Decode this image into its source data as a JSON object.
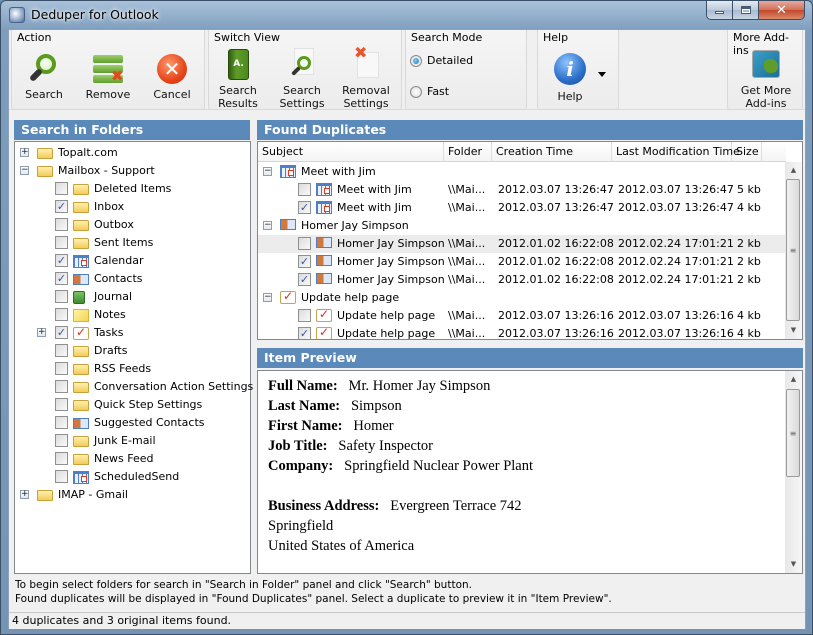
{
  "window": {
    "title": "Deduper for Outlook",
    "controls": {
      "minimize": "minimize",
      "maximize": "maximize",
      "close": "✕"
    }
  },
  "ribbon": {
    "groups": {
      "action": {
        "label": "Action",
        "buttons": [
          {
            "label": "Search",
            "icon": "magnifier-icon"
          },
          {
            "label": "Remove",
            "icon": "remove-stack-icon"
          },
          {
            "label": "Cancel",
            "icon": "cancel-icon"
          }
        ]
      },
      "switch_view": {
        "label": "Switch View",
        "buttons": [
          {
            "line1": "Search",
            "line2": "Results",
            "icon": "results-book-icon",
            "glyph": "A."
          },
          {
            "line1": "Search",
            "line2": "Settings",
            "icon": "search-settings-icon"
          },
          {
            "line1": "Removal",
            "line2": "Settings",
            "icon": "removal-settings-icon"
          }
        ]
      },
      "search_mode": {
        "label": "Search Mode",
        "options": [
          {
            "label": "Detailed",
            "selected": true
          },
          {
            "label": "Fast",
            "selected": false
          }
        ]
      },
      "help": {
        "label": "Help",
        "button": {
          "label": "Help",
          "glyph": "i",
          "icon": "info-icon"
        },
        "dropdown_arrow": "▼"
      },
      "more_addins": {
        "label": "More Add-ins",
        "button": {
          "line1": "Get More",
          "line2": "Add-ins",
          "icon": "addins-icon"
        }
      }
    }
  },
  "folders_panel": {
    "title": "Search in Folders",
    "tree": [
      {
        "label": "Topalt.com",
        "level": 0,
        "expander": "+",
        "icon": "folder",
        "checkbox": null
      },
      {
        "label": "Mailbox - Support",
        "level": 0,
        "expander": "−",
        "icon": "folder",
        "checkbox": null
      },
      {
        "label": "Deleted Items",
        "level": 1,
        "icon": "folder",
        "checked": false
      },
      {
        "label": "Inbox",
        "level": 1,
        "icon": "folder",
        "checked": true
      },
      {
        "label": "Outbox",
        "level": 1,
        "icon": "folder",
        "checked": false
      },
      {
        "label": "Sent Items",
        "level": 1,
        "icon": "folder",
        "checked": false
      },
      {
        "label": "Calendar",
        "level": 1,
        "icon": "calendar",
        "checked": true
      },
      {
        "label": "Contacts",
        "level": 1,
        "icon": "contact",
        "checked": true
      },
      {
        "label": "Journal",
        "level": 1,
        "icon": "journal",
        "checked": false
      },
      {
        "label": "Notes",
        "level": 1,
        "icon": "notes",
        "checked": false
      },
      {
        "label": "Tasks",
        "level": 1,
        "icon": "tasks",
        "checked": true,
        "expander": "+"
      },
      {
        "label": "Drafts",
        "level": 1,
        "icon": "folder",
        "checked": false
      },
      {
        "label": "RSS Feeds",
        "level": 1,
        "icon": "folder",
        "checked": false
      },
      {
        "label": "Conversation Action Settings",
        "level": 1,
        "icon": "folder",
        "checked": false
      },
      {
        "label": "Quick Step Settings",
        "level": 1,
        "icon": "folder",
        "checked": false
      },
      {
        "label": "Suggested Contacts",
        "level": 1,
        "icon": "contact",
        "checked": false
      },
      {
        "label": "Junk E-mail",
        "level": 1,
        "icon": "folder",
        "checked": false
      },
      {
        "label": "News Feed",
        "level": 1,
        "icon": "folder",
        "checked": false
      },
      {
        "label": "ScheduledSend",
        "level": 1,
        "icon": "calendar",
        "checked": false
      },
      {
        "label": "IMAP - Gmail",
        "level": 0,
        "expander": "+",
        "icon": "folder",
        "checkbox": null
      }
    ]
  },
  "duplicates_panel": {
    "title": "Found Duplicates",
    "columns": [
      "Subject",
      "Folder",
      "Creation Time",
      "Last Modification Time",
      "Size"
    ],
    "groups": [
      {
        "subject": "Meet with Jim",
        "icon": "calendar",
        "items": [
          {
            "subject": "Meet with Jim",
            "checked": false,
            "folder": "\\\\Mai...",
            "created": "2012.03.07 13:26:47",
            "modified": "2012.03.07 13:26:47",
            "size": "5 kb"
          },
          {
            "subject": "Meet with Jim",
            "checked": true,
            "folder": "\\\\Mai...",
            "created": "2012.03.07 13:26:47",
            "modified": "2012.03.07 13:26:47",
            "size": "4 kb"
          }
        ]
      },
      {
        "subject": "Homer Jay Simpson",
        "icon": "contact",
        "items": [
          {
            "subject": "Homer Jay Simpson",
            "checked": false,
            "selected": true,
            "folder": "\\\\Mai...",
            "created": "2012.01.02 16:22:08",
            "modified": "2012.02.24 17:01:21",
            "size": "2 kb"
          },
          {
            "subject": "Homer Jay Simpson",
            "checked": true,
            "folder": "\\\\Mai...",
            "created": "2012.01.02 16:22:08",
            "modified": "2012.02.24 17:01:21",
            "size": "2 kb"
          },
          {
            "subject": "Homer Jay Simpson",
            "checked": true,
            "folder": "\\\\Mai...",
            "created": "2012.01.02 16:22:08",
            "modified": "2012.02.24 17:01:21",
            "size": "2 kb"
          }
        ]
      },
      {
        "subject": "Update help page",
        "icon": "tasks",
        "items": [
          {
            "subject": "Update help page",
            "checked": false,
            "folder": "\\\\Mai...",
            "created": "2012.03.07 13:26:16",
            "modified": "2012.03.07 13:26:16",
            "size": "4 kb"
          },
          {
            "subject": "Update help page",
            "checked": true,
            "folder": "\\\\Mai...",
            "created": "2012.03.07 13:26:16",
            "modified": "2012.03.07 13:26:16",
            "size": "4 kb"
          }
        ]
      }
    ]
  },
  "preview_panel": {
    "title": "Item Preview",
    "fields": [
      {
        "label": "Full Name:",
        "value": "Mr. Homer Jay Simpson"
      },
      {
        "label": "Last Name:",
        "value": "Simpson"
      },
      {
        "label": "First Name:",
        "value": "Homer"
      },
      {
        "label": "Job Title:",
        "value": "Safety Inspector"
      },
      {
        "label": "Company:",
        "value": "Springfield Nuclear Power Plant"
      }
    ],
    "address": {
      "label": "Business Address:",
      "lines": [
        "Evergreen Terrace 742",
        "Springfield",
        "United States of America"
      ]
    }
  },
  "instructions": {
    "line1": "To begin select folders for search in \"Search in Folder\" panel and click \"Search\" button.",
    "line2": "Found duplicates will be displayed in \"Found Duplicates\" panel. Select a duplicate to preview it in \"Item Preview\"."
  },
  "status": {
    "text": "4 duplicates and 3 original items found."
  },
  "scroll": {
    "arrow_up": "▲",
    "arrow_down": "▼",
    "grip": "≡"
  },
  "colors": {
    "panel_header": "#5b89b9",
    "selected_row": "#ececec",
    "checkmark": "#3a57a8"
  }
}
